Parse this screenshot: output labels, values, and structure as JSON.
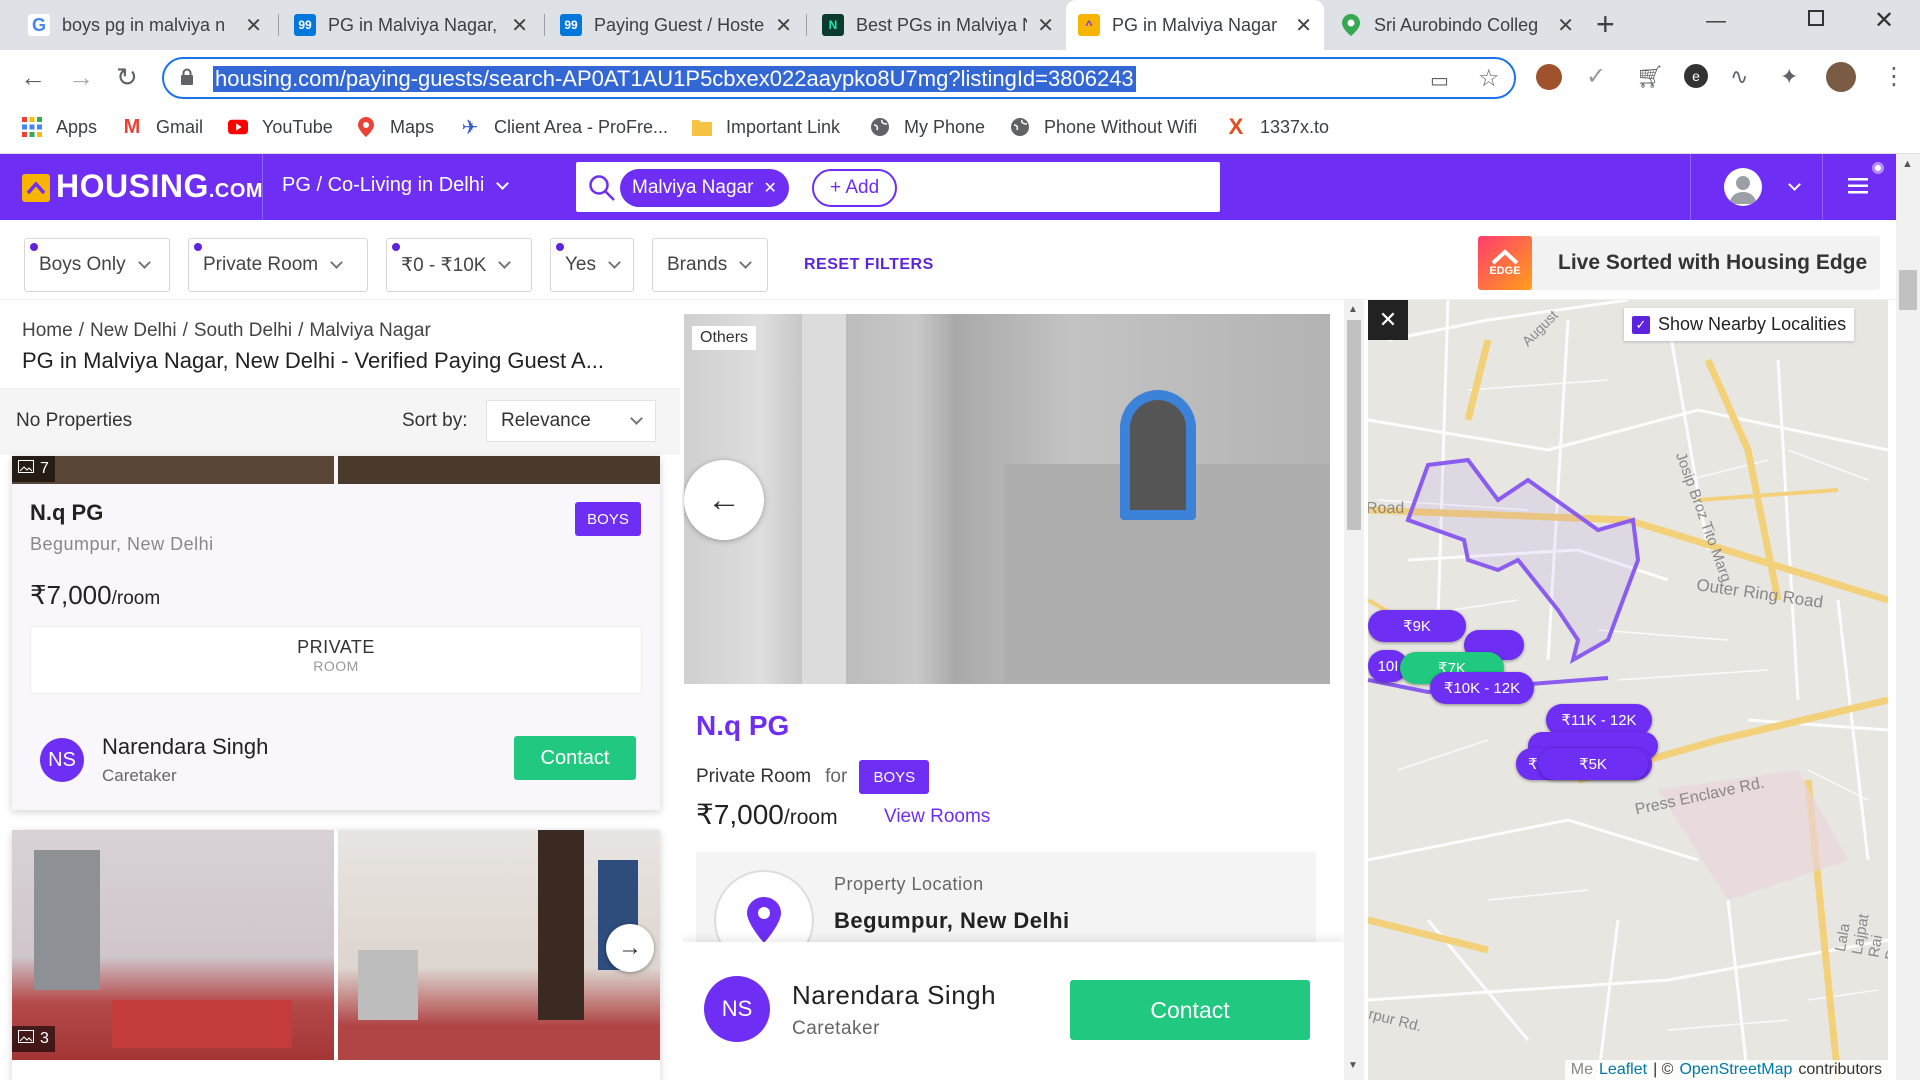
{
  "browser": {
    "tabs": [
      {
        "title": "boys pg in malviya n",
        "favicon": "google-icon",
        "color": "#4285f4"
      },
      {
        "title": "PG in Malviya Nagar,",
        "favicon": "99acres-icon",
        "color": "#0078db"
      },
      {
        "title": "Paying Guest / Hoste",
        "favicon": "99acres-icon",
        "color": "#0078db"
      },
      {
        "title": "Best PGs in Malviya N",
        "favicon": "nobroker-icon",
        "color": "#1abc9c"
      },
      {
        "title": "PG in Malviya Nagar",
        "favicon": "housing-icon",
        "color": "#f7b500"
      },
      {
        "title": "Sri Aurobindo Colleg",
        "favicon": "maps-pin-icon",
        "color": "#34a853"
      }
    ],
    "active_tab_index": 4,
    "url": "housing.com/paying-guests/search-AP0AT1AU1P5cbxex022aaypko8U7mg?listingId=3806243",
    "bookmarks": [
      {
        "label": "Apps",
        "icon": "apps-grid-icon"
      },
      {
        "label": "Gmail",
        "icon": "gmail-icon"
      },
      {
        "label": "YouTube",
        "icon": "youtube-icon"
      },
      {
        "label": "Maps",
        "icon": "maps-icon"
      },
      {
        "label": "Client Area - ProFre...",
        "icon": "client-area-icon"
      },
      {
        "label": "Important Link",
        "icon": "folder-icon"
      },
      {
        "label": "My Phone",
        "icon": "globe-icon"
      },
      {
        "label": "Phone Without Wifi",
        "icon": "globe-icon"
      },
      {
        "label": "1337x.to",
        "icon": "x-site-icon"
      }
    ]
  },
  "header": {
    "logo": "HOUSING.COM",
    "logo_main": "HOUSING",
    "logo_suffix": ".COM",
    "category": "PG / Co-Living in Delhi",
    "search_chip": "Malviya Nagar",
    "add_label": "+ Add"
  },
  "filters": {
    "items": [
      "Boys Only",
      "Private Room",
      "₹0 - ₹10K",
      "Yes",
      "Brands"
    ],
    "reset": "RESET FILTERS",
    "edge_badge": "EDGE",
    "edge_text": "Live Sorted with Housing Edge"
  },
  "listing": {
    "breadcrumb": [
      "Home",
      "New Delhi",
      "South Delhi",
      "Malviya Nagar"
    ],
    "page_title": "PG in Malviya Nagar, New Delhi - Verified Paying Guest A...",
    "count_text": "No Properties",
    "sort_label": "Sort by:",
    "sort_value": "Relevance",
    "cards": [
      {
        "photo_count": "7",
        "name": "N.q PG",
        "locality": "Begumpur, New Delhi",
        "tag": "BOYS",
        "price": "₹7,000",
        "price_unit": "/room",
        "room_type": "PRIVATE",
        "room_sub": "ROOM",
        "contact_initials": "NS",
        "contact_name": "Narendara Singh",
        "contact_role": "Caretaker",
        "contact_btn": "Contact"
      },
      {
        "photo_count": "3"
      }
    ]
  },
  "detail": {
    "photo_tag": "Others",
    "name": "N.q PG",
    "room_type": "Private Room",
    "for_label": "for",
    "tag": "BOYS",
    "price": "₹7,000",
    "price_unit": "/room",
    "view_rooms": "View Rooms",
    "location_label": "Property Location",
    "location": "Begumpur, New Delhi",
    "contact_initials": "NS",
    "contact_name": "Narendara Singh",
    "contact_role": "Caretaker",
    "contact_btn": "Contact"
  },
  "map": {
    "nearby_label": "Show Nearby Localities",
    "nearby_checked": true,
    "roads": [
      "Outer Ring Road",
      "Josip Broz Tito Marg",
      "Press Enclave Rd.",
      "Lala Lajpat Rai Path",
      "August",
      "Road",
      "rpur Rd."
    ],
    "price_pins": [
      "₹9K",
      "10I",
      "₹7K",
      "₹10K - 12K",
      "₹11K - 12K",
      "₹",
      "₹5K"
    ],
    "attribution_prefix": "Me",
    "attribution_leaflet": "Leaflet",
    "attribution_sep": "| ©",
    "attribution_osm": "OpenStreetMap",
    "attribution_suffix": "contributors"
  }
}
